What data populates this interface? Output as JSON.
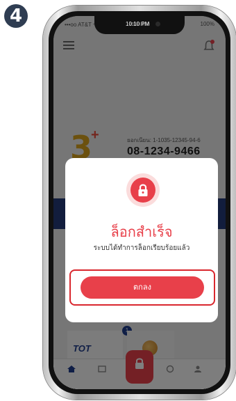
{
  "step": {
    "number": "4"
  },
  "status_bar": {
    "carrier": "•••oo AT&T ᯤ",
    "time": "10:10 PM",
    "battery": "100%"
  },
  "account": {
    "brand_mark": "3",
    "brand_plus": "+",
    "account_number": "ยอกเนียน: 1-1035-12345-94-6",
    "phone_number": "08-1234-9466"
  },
  "services": {
    "provider_logo": "TOT",
    "badge_count": "1"
  },
  "modal": {
    "icon": "lock-icon",
    "title": "ล็อกสำเร็จ",
    "description": "ระบบได้ทำการล็อกเรียบร้อยแล้ว",
    "ok_button": "ตกลง"
  },
  "colors": {
    "accent": "#e8404a",
    "highlight_frame": "#d9272e",
    "brand_blue": "#243a7a"
  }
}
